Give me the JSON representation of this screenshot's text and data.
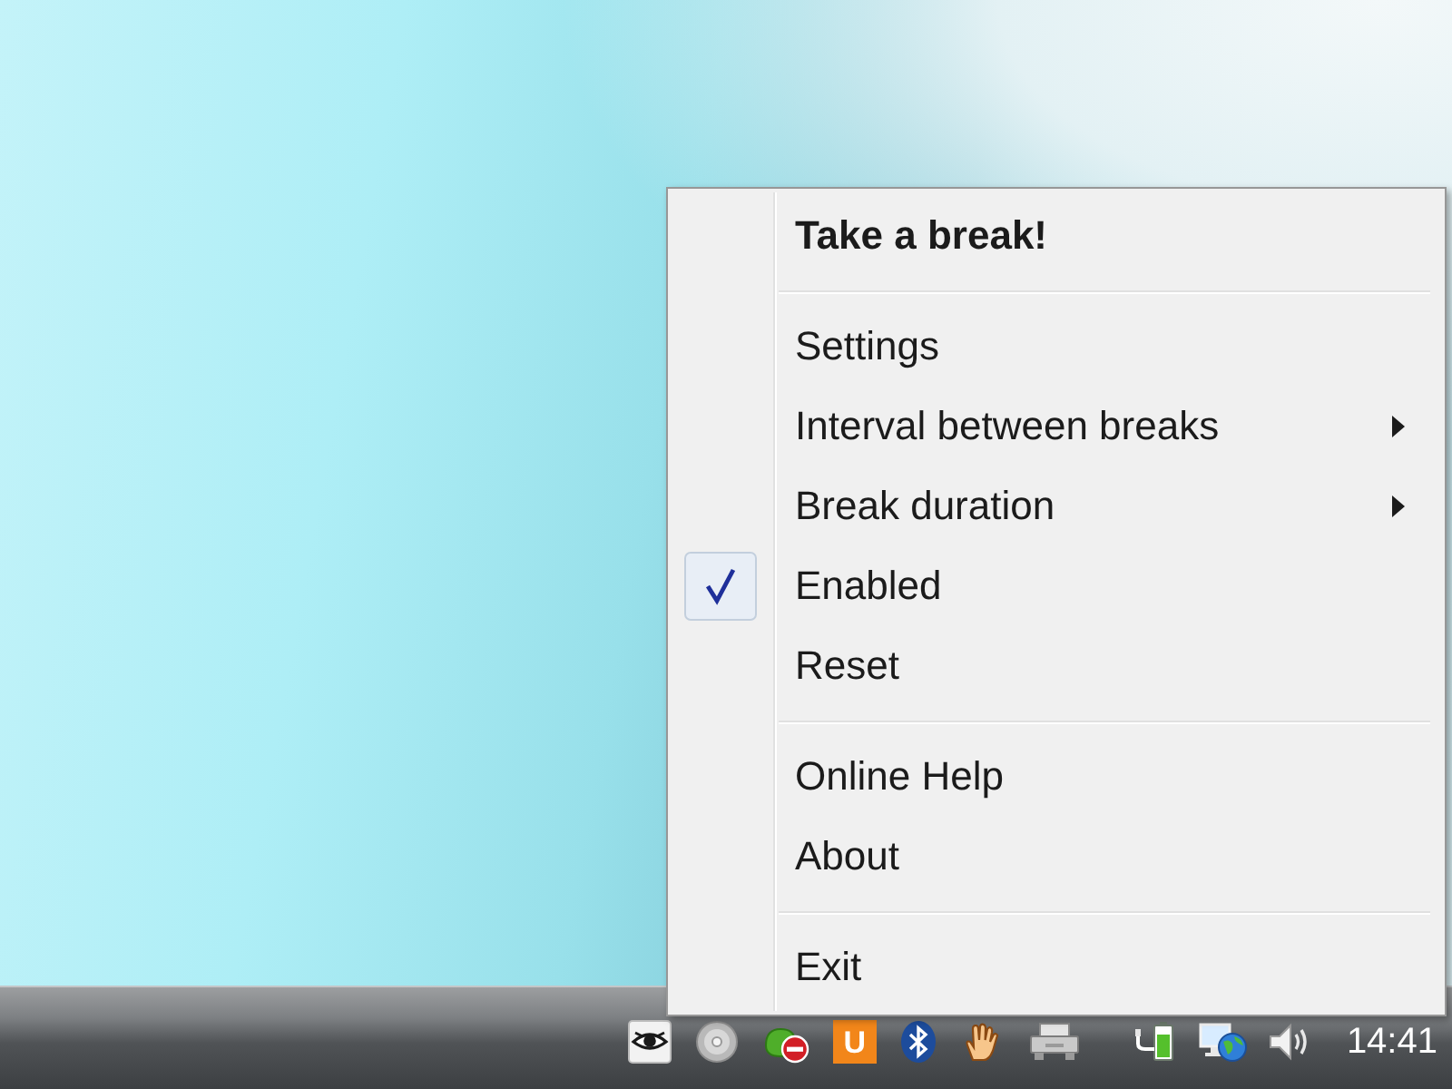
{
  "context_menu": {
    "items": [
      {
        "kind": "item",
        "label": "Take a break!",
        "default": true,
        "checked": false,
        "submenu": false
      },
      {
        "kind": "separator"
      },
      {
        "kind": "item",
        "label": "Settings",
        "default": false,
        "checked": false,
        "submenu": false
      },
      {
        "kind": "item",
        "label": "Interval between breaks",
        "default": false,
        "checked": false,
        "submenu": true
      },
      {
        "kind": "item",
        "label": "Break duration",
        "default": false,
        "checked": false,
        "submenu": true
      },
      {
        "kind": "item",
        "label": "Enabled",
        "default": false,
        "checked": true,
        "submenu": false
      },
      {
        "kind": "item",
        "label": "Reset",
        "default": false,
        "checked": false,
        "submenu": false
      },
      {
        "kind": "separator"
      },
      {
        "kind": "item",
        "label": "Online Help",
        "default": false,
        "checked": false,
        "submenu": false
      },
      {
        "kind": "item",
        "label": "About",
        "default": false,
        "checked": false,
        "submenu": false
      },
      {
        "kind": "separator"
      },
      {
        "kind": "item",
        "label": "Exit",
        "default": false,
        "checked": false,
        "submenu": false
      }
    ]
  },
  "taskbar": {
    "notification_icons": [
      {
        "kind": "eye"
      },
      {
        "kind": "disc"
      },
      {
        "kind": "stop"
      },
      {
        "kind": "letter",
        "text": "U"
      },
      {
        "kind": "bluetooth"
      },
      {
        "kind": "hand"
      },
      {
        "kind": "printer"
      }
    ],
    "system_icons": [
      {
        "kind": "battery"
      },
      {
        "kind": "network"
      },
      {
        "kind": "speaker"
      }
    ],
    "clock": "14:41"
  }
}
